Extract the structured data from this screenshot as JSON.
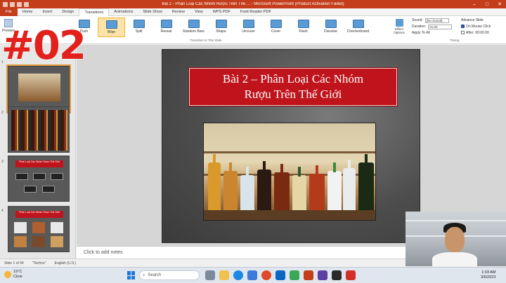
{
  "window": {
    "title": "Bài 2 - Phân Loại Các Nhóm Rượu Trên Thế ... - Microsoft PowerPoint (Product Activation Failed)",
    "controls": [
      "–",
      "□",
      "✕"
    ]
  },
  "ribbon_tabs": [
    {
      "label": "File"
    },
    {
      "label": "Home"
    },
    {
      "label": "Insert"
    },
    {
      "label": "Design"
    },
    {
      "label": "Transitions"
    },
    {
      "label": "Animations"
    },
    {
      "label": "Slide Show"
    },
    {
      "label": "Review"
    },
    {
      "label": "View"
    },
    {
      "label": "WPS PDF"
    },
    {
      "label": "Foxit Reader PDF"
    }
  ],
  "active_tab": "Transitions",
  "ribbon": {
    "preview_label": "Preview",
    "transitions": [
      "Push",
      "Wipe",
      "Split",
      "Reveal",
      "Random Bars",
      "Shape",
      "Uncover",
      "Cover",
      "Flash",
      "Dissolve",
      "Checkerboard"
    ],
    "active_transition": "Wipe",
    "effect_options_label": "Effect Options",
    "group_label": "Transition to This Slide",
    "timing": {
      "sound_label": "Sound:",
      "sound_value": "[No Sound]",
      "duration_label": "Duration:",
      "duration_value": "01.00",
      "apply_all_label": "Apply To All",
      "group_label": "Timing"
    },
    "advance": {
      "title": "Advance Slide",
      "on_mouse_click": "On Mouse Click",
      "after_label": "After:",
      "after_value": "00:00.00"
    }
  },
  "thumbnails": [
    {
      "num": "1",
      "title": ""
    },
    {
      "num": "2",
      "title": ""
    },
    {
      "num": "3",
      "title": "Phân Loại Các Nhóm Rượu Thế Giới"
    },
    {
      "num": "4",
      "title": "Phân Loại Các Nhóm Rượu Thế Giới"
    }
  ],
  "slide": {
    "title_line1": "Bài 2 – Phân Loại Các Nhóm",
    "title_line2": "Rượu Trên Thế Giới"
  },
  "overlay_badge": "#02",
  "notes_placeholder": "Click to add notes",
  "status_bar": {
    "slide_info": "Slide 1 of 64",
    "theme": "\"Techno\"",
    "language": "English (U.S.)"
  },
  "taskbar": {
    "weather_temp": "19°C",
    "weather_desc": "Clear",
    "search_placeholder": "Search",
    "time": "1:03 AM",
    "date": "3/6/2023"
  },
  "colors": {
    "accent": "#c43e1c",
    "slide_title_bg": "#c0141c",
    "badge": "#e2211c"
  }
}
